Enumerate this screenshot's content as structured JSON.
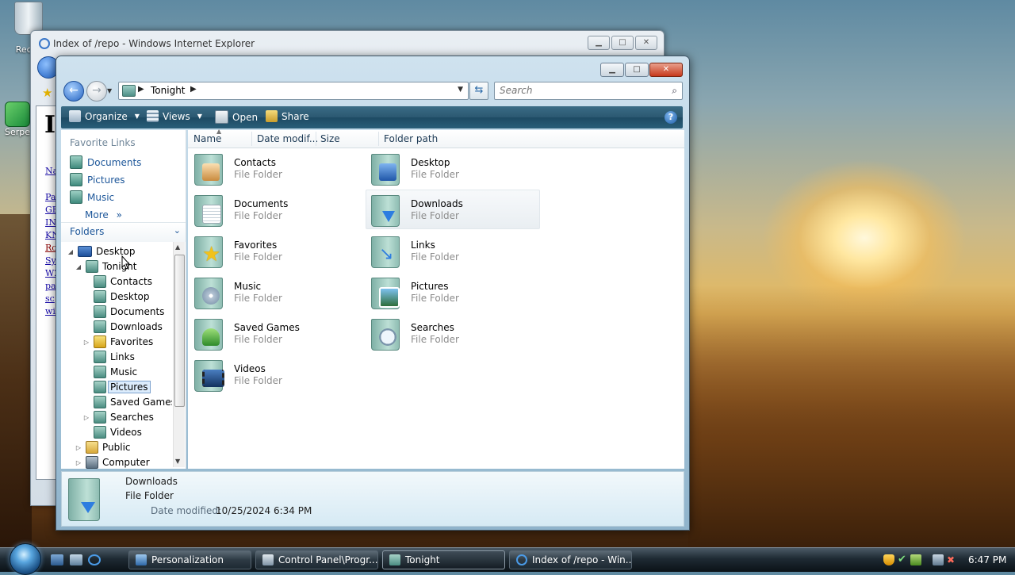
{
  "desktop": {
    "icons": [
      {
        "label": "Recycle Bin",
        "visible_label": "Recyc"
      },
      {
        "label": "Serpent",
        "visible_label": "Serpe"
      }
    ]
  },
  "ie_window": {
    "title": "Index of /repo - Windows Internet Explorer",
    "page_heading_initial": "I",
    "links": [
      "Na",
      "Pa",
      "GE",
      "IN",
      "KN",
      "Ro",
      "Sy",
      "W2",
      "pa",
      "sc",
      "wi"
    ]
  },
  "explorer": {
    "breadcrumb": [
      "Tonight"
    ],
    "search": {
      "placeholder": "Search"
    },
    "toolbar": {
      "organize": "Organize",
      "views": "Views",
      "open": "Open",
      "share": "Share",
      "help": "?"
    },
    "favorites": {
      "header": "Favorite Links",
      "items": [
        "Documents",
        "Pictures",
        "Music"
      ],
      "more": "More"
    },
    "folders": {
      "label": "Folders",
      "tree": [
        {
          "label": "Desktop",
          "level": 0,
          "expanded": true
        },
        {
          "label": "Tonight",
          "level": 1,
          "expanded": true
        },
        {
          "label": "Contacts",
          "level": 2
        },
        {
          "label": "Desktop",
          "level": 2
        },
        {
          "label": "Documents",
          "level": 2
        },
        {
          "label": "Downloads",
          "level": 2
        },
        {
          "label": "Favorites",
          "level": 2,
          "collapsed": true
        },
        {
          "label": "Links",
          "level": 2
        },
        {
          "label": "Music",
          "level": 2
        },
        {
          "label": "Pictures",
          "level": 2,
          "selected": true
        },
        {
          "label": "Saved Games",
          "level": 2
        },
        {
          "label": "Searches",
          "level": 2,
          "collapsed": true
        },
        {
          "label": "Videos",
          "level": 2
        },
        {
          "label": "Public",
          "level": 1,
          "collapsed": true
        },
        {
          "label": "Computer",
          "level": 1,
          "collapsed": true
        }
      ]
    },
    "columns": [
      "Name",
      "Date modif...",
      "Size",
      "Folder path"
    ],
    "items": [
      {
        "name": "Contacts",
        "type": "File Folder",
        "icon": "contacts-icon"
      },
      {
        "name": "Desktop",
        "type": "File Folder",
        "icon": "desktop-icon"
      },
      {
        "name": "Documents",
        "type": "File Folder",
        "icon": "documents-icon"
      },
      {
        "name": "Downloads",
        "type": "File Folder",
        "icon": "downloads-icon",
        "hot": true
      },
      {
        "name": "Favorites",
        "type": "File Folder",
        "icon": "favorites-icon"
      },
      {
        "name": "Links",
        "type": "File Folder",
        "icon": "links-icon"
      },
      {
        "name": "Music",
        "type": "File Folder",
        "icon": "music-icon"
      },
      {
        "name": "Pictures",
        "type": "File Folder",
        "icon": "pictures-icon"
      },
      {
        "name": "Saved Games",
        "type": "File Folder",
        "icon": "saved-games-icon"
      },
      {
        "name": "Searches",
        "type": "File Folder",
        "icon": "searches-icon"
      },
      {
        "name": "Videos",
        "type": "File Folder",
        "icon": "videos-icon"
      }
    ],
    "details": {
      "name": "Downloads",
      "type": "File Folder",
      "date_modified_label": "Date modified:",
      "date_modified_value": "10/25/2024 6:34 PM"
    }
  },
  "taskbar": {
    "buttons": [
      {
        "label": "Personalization"
      },
      {
        "label": "Control Panel\\Progr..."
      },
      {
        "label": "Tonight",
        "active": true
      },
      {
        "label": "Index of /repo - Win..."
      }
    ],
    "clock": "6:47 PM"
  },
  "colors": {
    "toolbar": "#2b5871",
    "link": "#1c5699",
    "selection": "#dcecfc"
  }
}
